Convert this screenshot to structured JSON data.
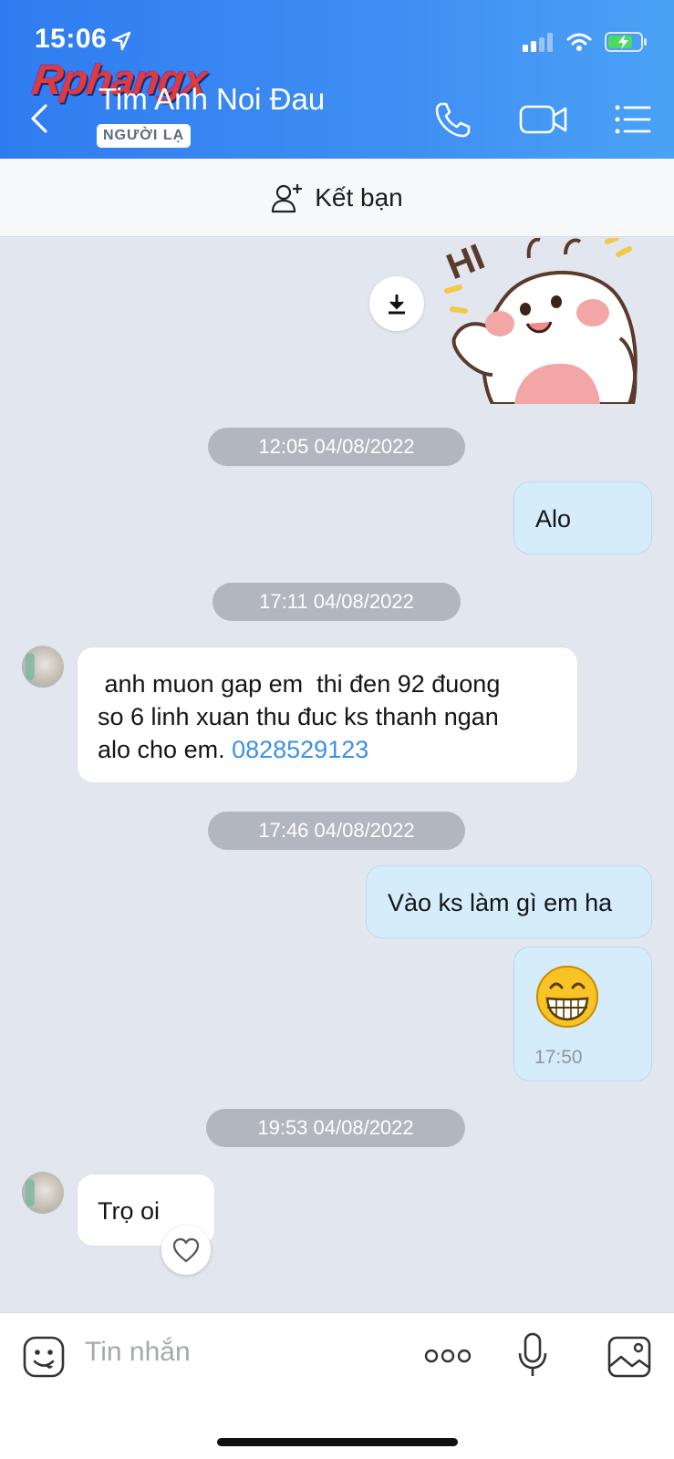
{
  "status_bar": {
    "time": "15:06"
  },
  "watermark": "Rphangx",
  "header": {
    "contact_name": "Tim Anh Noi Đau",
    "badge": "NGƯỜI LẠ",
    "colors": {
      "gradient_start": "#2f7cf0",
      "gradient_end": "#4aa2f5"
    }
  },
  "friend_bar": {
    "label": "Kết bạn"
  },
  "messages": [
    {
      "type": "timestamp",
      "text": "12:05 04/08/2022"
    },
    {
      "type": "outgoing",
      "text": "Alo"
    },
    {
      "type": "timestamp",
      "text": "17:11 04/08/2022"
    },
    {
      "type": "incoming",
      "line1": " anh muon gap em  thi đen 92 đuong",
      "line2": "so 6 linh xuan thu đuc ks thanh ngan",
      "line3_prefix": "alo cho em. ",
      "phone": "0828529123"
    },
    {
      "type": "timestamp",
      "text": "17:46 04/08/2022"
    },
    {
      "type": "outgoing",
      "text": "Vào ks làm gì em ha"
    },
    {
      "type": "outgoing_emoji",
      "emoji": "😁",
      "time": "17:50"
    },
    {
      "type": "timestamp",
      "text": "19:53 04/08/2022"
    },
    {
      "type": "incoming",
      "text": "Trọ oi"
    }
  ],
  "input_bar": {
    "placeholder": "Tin nhắn"
  },
  "colors": {
    "chat_bg": "#e2e6ee",
    "outgoing_bubble": "#d5ecfb",
    "link": "#3d8fe8",
    "stamp": "#b2b6be"
  }
}
